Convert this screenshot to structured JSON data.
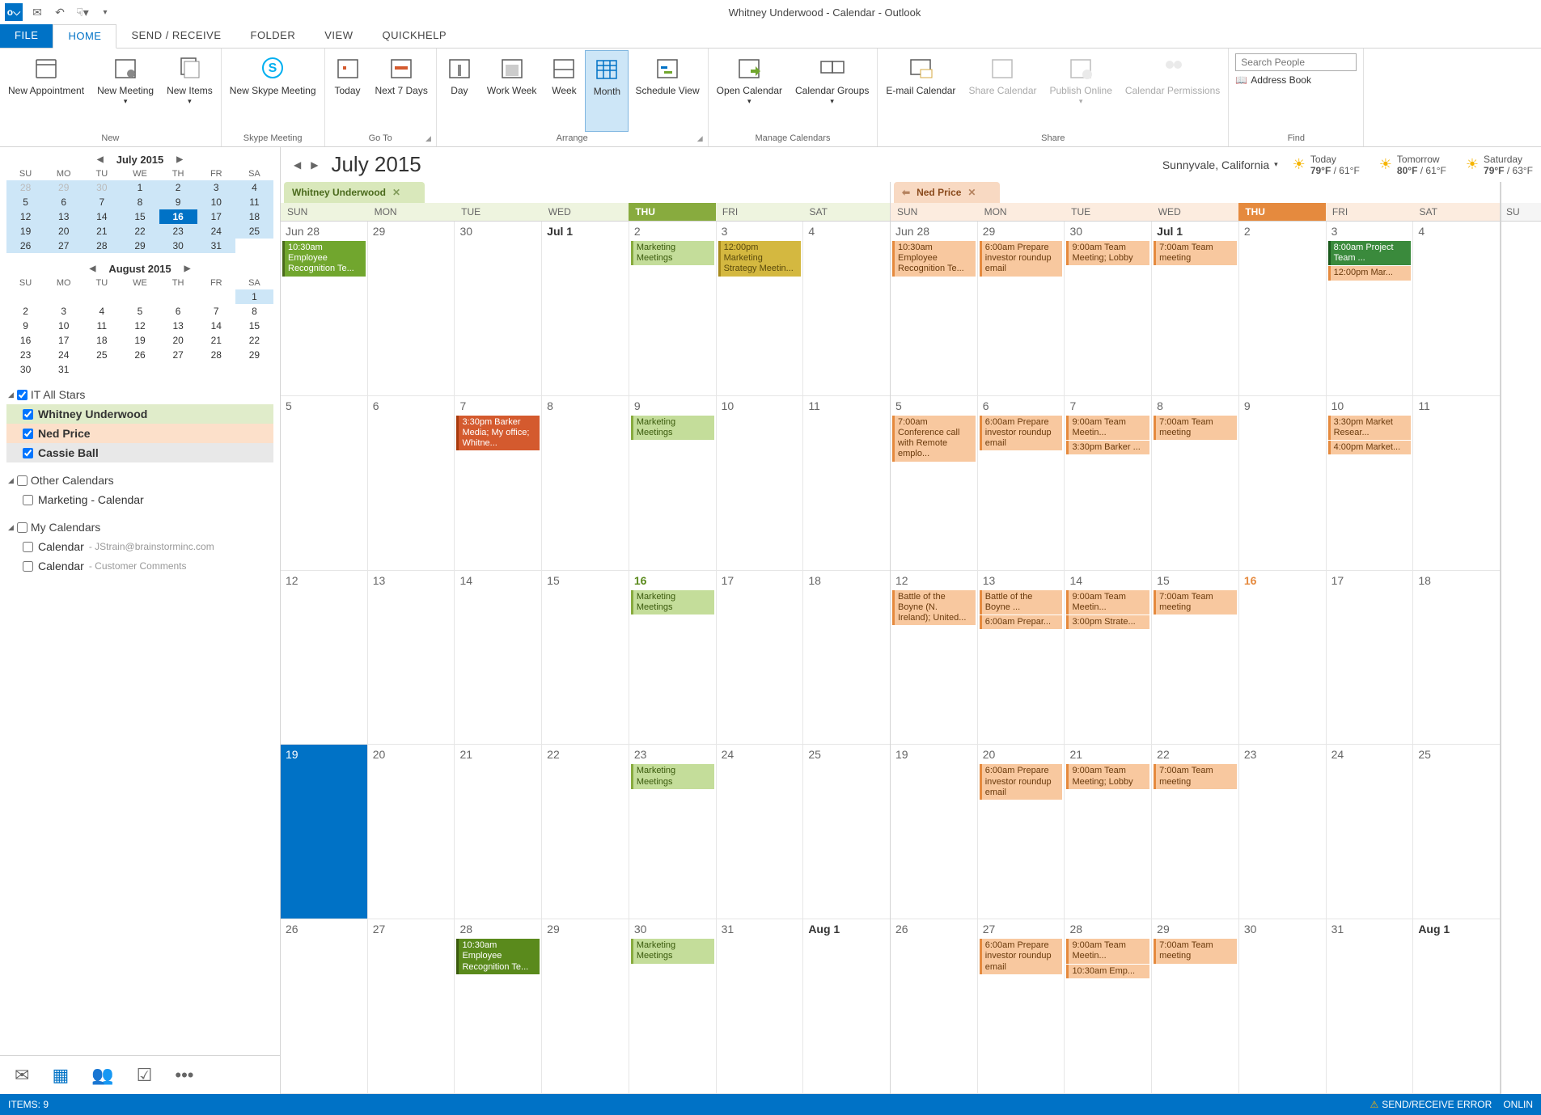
{
  "window_title": "Whitney Underwood - Calendar - Outlook",
  "tabs": {
    "file": "FILE",
    "home": "HOME",
    "sendreceive": "SEND / RECEIVE",
    "folder": "FOLDER",
    "view": "VIEW",
    "quickhelp": "QUICKHELP"
  },
  "ribbon_groups": {
    "new": "New",
    "skype": "Skype Meeting",
    "goto": "Go To",
    "arrange": "Arrange",
    "manage": "Manage Calendars",
    "share": "Share",
    "find": "Find"
  },
  "ribbon": {
    "new_appt": "New Appointment",
    "new_meeting": "New Meeting",
    "new_items": "New Items",
    "skype": "New Skype Meeting",
    "today": "Today",
    "next7": "Next 7 Days",
    "day": "Day",
    "workweek": "Work Week",
    "week": "Week",
    "month": "Month",
    "schedule": "Schedule View",
    "opencal": "Open Calendar",
    "calgroups": "Calendar Groups",
    "email": "E-mail Calendar",
    "share": "Share Calendar",
    "publish": "Publish Online",
    "perm": "Calendar Permissions",
    "search_ph": "Search People",
    "addrbook": "Address Book"
  },
  "mini1": {
    "title": "July 2015",
    "dow": [
      "SU",
      "MO",
      "TU",
      "WE",
      "TH",
      "FR",
      "SA"
    ],
    "rows": [
      [
        "28",
        "29",
        "30",
        "1",
        "2",
        "3",
        "4"
      ],
      [
        "5",
        "6",
        "7",
        "8",
        "9",
        "10",
        "11"
      ],
      [
        "12",
        "13",
        "14",
        "15",
        "16",
        "17",
        "18"
      ],
      [
        "19",
        "20",
        "21",
        "22",
        "23",
        "24",
        "25"
      ],
      [
        "26",
        "27",
        "28",
        "29",
        "30",
        "31",
        ""
      ]
    ],
    "dim_first": 3,
    "today": "16"
  },
  "mini2": {
    "title": "August 2015",
    "dow": [
      "SU",
      "MO",
      "TU",
      "WE",
      "TH",
      "FR",
      "SA"
    ],
    "rows": [
      [
        "",
        "",
        "",
        "",
        "",
        "",
        "1"
      ],
      [
        "2",
        "3",
        "4",
        "5",
        "6",
        "7",
        "8"
      ],
      [
        "9",
        "10",
        "11",
        "12",
        "13",
        "14",
        "15"
      ],
      [
        "16",
        "17",
        "18",
        "19",
        "20",
        "21",
        "22"
      ],
      [
        "23",
        "24",
        "25",
        "26",
        "27",
        "28",
        "29"
      ],
      [
        "30",
        "31",
        "",
        "",
        "",
        "",
        ""
      ]
    ]
  },
  "groups": {
    "g1": "IT All Stars",
    "g1_items": [
      {
        "l": "Whitney Underwood",
        "c": "whit"
      },
      {
        "l": "Ned Price",
        "c": "ned"
      },
      {
        "l": "Cassie Ball",
        "c": "cas"
      }
    ],
    "g2": "Other Calendars",
    "g2_items": [
      "Marketing - Calendar"
    ],
    "g3": "My Calendars",
    "g3_items": [
      {
        "l": "Calendar",
        "s": "JStrain@brainstorminc.com"
      },
      {
        "l": "Calendar",
        "s": "Customer Comments"
      }
    ]
  },
  "calhdr": {
    "title": "July 2015",
    "loc": "Sunnyvale, California",
    "w": [
      {
        "d": "Today",
        "t": "79°F / 61°F"
      },
      {
        "d": "Tomorrow",
        "t": "80°F / 61°F"
      },
      {
        "d": "Saturday",
        "t": "79°F / 63°F"
      }
    ]
  },
  "caltabs": {
    "whit": "Whitney Underwood",
    "ned": "Ned Price"
  },
  "dow": [
    "SUN",
    "MON",
    "TUE",
    "WED",
    "THU",
    "FRI",
    "SAT"
  ],
  "weeks_nums": [
    [
      "Jun 28",
      "29",
      "30",
      "Jul 1",
      "2",
      "3",
      "4"
    ],
    [
      "5",
      "6",
      "7",
      "8",
      "9",
      "10",
      "11"
    ],
    [
      "12",
      "13",
      "14",
      "15",
      "16",
      "17",
      "18"
    ],
    [
      "19",
      "20",
      "21",
      "22",
      "23",
      "24",
      "25"
    ],
    [
      "26",
      "27",
      "28",
      "29",
      "30",
      "31",
      "Aug 1"
    ]
  ],
  "bold_nums": [
    "Jul 1",
    "Aug 1"
  ],
  "today_idx": [
    2,
    4
  ],
  "selected_idx": [
    3,
    0
  ],
  "events_whit": {
    "0,0": [
      {
        "c": "green1",
        "t": "10:30am Employee Recognition Te..."
      }
    ],
    "0,4": [
      {
        "c": "green2",
        "t": "Marketing Meetings"
      }
    ],
    "0,5": [
      {
        "c": "yellow",
        "t": "12:00pm Marketing Strategy Meetin..."
      }
    ],
    "1,2": [
      {
        "c": "red",
        "t": "3:30pm Barker Media; My office; Whitne..."
      }
    ],
    "1,4": [
      {
        "c": "green2",
        "t": "Marketing Meetings"
      }
    ],
    "2,4": [
      {
        "c": "green2",
        "t": "Marketing Meetings"
      }
    ],
    "3,4": [
      {
        "c": "green2",
        "t": "Marketing Meetings"
      }
    ],
    "4,2": [
      {
        "c": "green3",
        "t": "10:30am Employee Recognition Te..."
      }
    ],
    "4,4": [
      {
        "c": "green2",
        "t": "Marketing Meetings"
      }
    ]
  },
  "events_ned": {
    "0,0": [
      {
        "c": "orange1",
        "t": "10:30am Employee Recognition Te..."
      }
    ],
    "0,1": [
      {
        "c": "orange1",
        "t": "6:00am Prepare investor roundup email"
      }
    ],
    "0,2": [
      {
        "c": "orange1",
        "t": "9:00am Team Meeting; Lobby"
      }
    ],
    "0,3": [
      {
        "c": "orange1",
        "t": "7:00am Team meeting"
      }
    ],
    "0,5": [
      {
        "c": "dgreen",
        "t": "8:00am Project Team ..."
      },
      {
        "c": "orange1",
        "t": "12:00pm Mar..."
      }
    ],
    "1,0": [
      {
        "c": "orange1",
        "t": "7:00am Conference call with Remote emplo..."
      }
    ],
    "1,1": [
      {
        "c": "orange1",
        "t": "6:00am Prepare investor roundup email"
      }
    ],
    "1,2": [
      {
        "c": "orange1",
        "t": "9:00am Team Meetin..."
      },
      {
        "c": "orange1",
        "t": "3:30pm Barker ..."
      }
    ],
    "1,3": [
      {
        "c": "orange1",
        "t": "7:00am Team meeting"
      }
    ],
    "1,5": [
      {
        "c": "orange1",
        "t": "3:30pm Market Resear..."
      },
      {
        "c": "orange1",
        "t": "4:00pm Market..."
      }
    ],
    "2,0": [
      {
        "c": "orange1",
        "t": "Battle of the Boyne (N. Ireland); United..."
      }
    ],
    "2,1": [
      {
        "c": "orange1",
        "t": "Battle of the Boyne ..."
      },
      {
        "c": "orange1",
        "t": "6:00am Prepar..."
      }
    ],
    "2,2": [
      {
        "c": "orange1",
        "t": "9:00am Team Meetin..."
      },
      {
        "c": "orange1",
        "t": "3:00pm Strate..."
      }
    ],
    "2,3": [
      {
        "c": "orange1",
        "t": "7:00am Team meeting"
      }
    ],
    "3,1": [
      {
        "c": "orange1",
        "t": "6:00am Prepare investor roundup email"
      }
    ],
    "3,2": [
      {
        "c": "orange1",
        "t": "9:00am Team Meeting; Lobby"
      }
    ],
    "3,3": [
      {
        "c": "orange1",
        "t": "7:00am Team meeting"
      }
    ],
    "4,1": [
      {
        "c": "orange1",
        "t": "6:00am Prepare investor roundup email"
      }
    ],
    "4,2": [
      {
        "c": "orange1",
        "t": "9:00am Team Meetin..."
      },
      {
        "c": "orange1",
        "t": "10:30am Emp..."
      }
    ],
    "4,3": [
      {
        "c": "orange1",
        "t": "7:00am Team meeting"
      }
    ]
  },
  "rightcal_dow": "SU",
  "status": {
    "items": "ITEMS: 9",
    "err": "SEND/RECEIVE ERROR",
    "online": "ONLIN"
  }
}
